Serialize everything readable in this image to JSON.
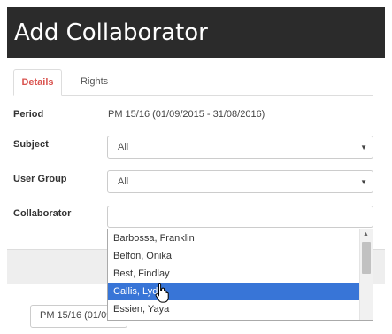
{
  "header": {
    "title": "Add Collaborator"
  },
  "tabs": [
    {
      "label": "Details",
      "active": true
    },
    {
      "label": "Rights",
      "active": false
    }
  ],
  "form": {
    "period": {
      "label": "Period",
      "value": "PM 15/16 (01/09/2015 - 31/08/2016)"
    },
    "subject": {
      "label": "Subject",
      "selected": "All"
    },
    "user_group": {
      "label": "User Group",
      "selected": "All"
    },
    "collaborator": {
      "label": "Collaborator",
      "value": "",
      "options": [
        "Barbossa, Franklin",
        "Belfon, Onika",
        "Best, Findlay",
        "Callis, Lydia",
        "Essien, Yaya"
      ],
      "highlighted_option": "Callis, Lydia"
    }
  },
  "footer": {
    "period_button_label": "PM 15/16 (01/09/2015 - 31/08/2016)"
  },
  "colors": {
    "title_bg": "#2b2b2b",
    "active_tab": "#d9534f",
    "highlight": "#3875d7"
  },
  "icons": {
    "caret": "caret-down-icon",
    "cursor": "hand-pointer-icon",
    "scroll_up": "scroll-up-arrow-icon"
  }
}
